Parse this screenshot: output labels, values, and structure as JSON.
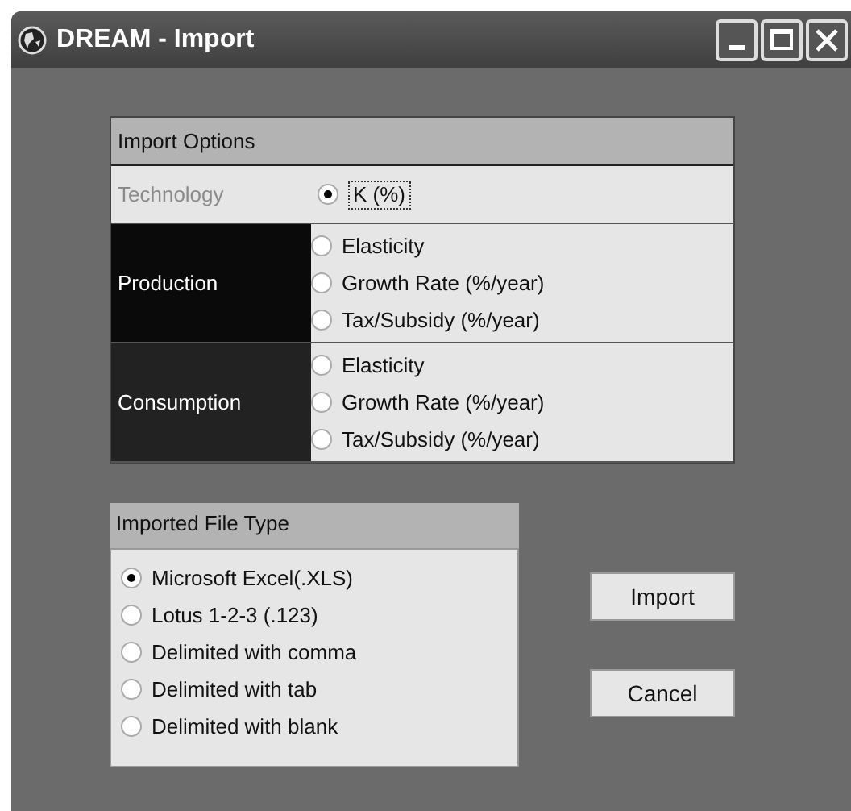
{
  "window": {
    "title": "DREAM - Import"
  },
  "import_options": {
    "title": "Import Options",
    "groups": [
      {
        "label": "Technology",
        "disabled": true,
        "color": "#e6e6e6",
        "options": [
          {
            "label": "K (%)",
            "selected": true
          }
        ]
      },
      {
        "label": "Production",
        "disabled": false,
        "color": "#0a0a0a",
        "options": [
          {
            "label": "Elasticity",
            "selected": false
          },
          {
            "label": "Growth Rate  (%/year)",
            "selected": false
          },
          {
            "label": "Tax/Subsidy (%/year)",
            "selected": false
          }
        ]
      },
      {
        "label": "Consumption",
        "disabled": false,
        "color": "#222222",
        "options": [
          {
            "label": "Elasticity",
            "selected": false
          },
          {
            "label": "Growth Rate  (%/year)",
            "selected": false
          },
          {
            "label": "Tax/Subsidy (%/year)",
            "selected": false
          }
        ]
      }
    ]
  },
  "file_type": {
    "title": "Imported File Type",
    "options": [
      {
        "label": "Microsoft Excel(.XLS)",
        "selected": true
      },
      {
        "label": "Lotus 1-2-3 (.123)",
        "selected": false
      },
      {
        "label": "Delimited with comma",
        "selected": false
      },
      {
        "label": "Delimited with tab",
        "selected": false
      },
      {
        "label": "Delimited with blank",
        "selected": false
      }
    ]
  },
  "buttons": [
    "Import",
    "Cancel"
  ]
}
